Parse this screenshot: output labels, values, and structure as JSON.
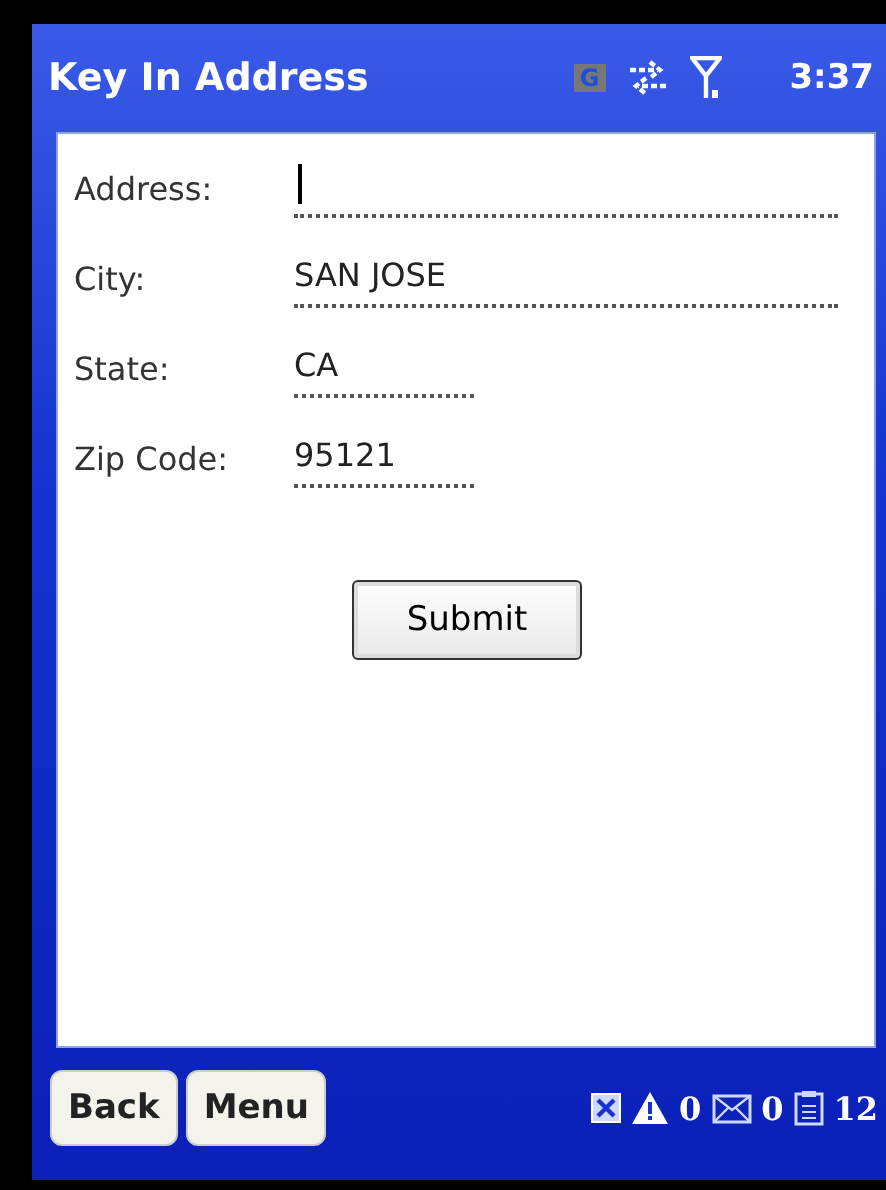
{
  "title_bar": {
    "title": "Key In Address",
    "network_badge": "G",
    "time": "3:37"
  },
  "form": {
    "fields": [
      {
        "label": "Address:",
        "kind": "wide",
        "focused": true
      },
      {
        "label": "City:",
        "value": "SAN JOSE",
        "kind": "wide",
        "focused": false
      },
      {
        "label": "State:",
        "value": "CA",
        "kind": "short",
        "focused": false
      },
      {
        "label": "Zip Code:",
        "value": "95121",
        "kind": "short",
        "focused": false
      }
    ],
    "submit": "Submit"
  },
  "bottom_bar": {
    "buttons": [
      "Back",
      "Menu"
    ],
    "counters": [
      {
        "kind": "warning",
        "count": "0"
      },
      {
        "kind": "mail",
        "count": "0"
      },
      {
        "kind": "task",
        "count": "12"
      }
    ]
  }
}
